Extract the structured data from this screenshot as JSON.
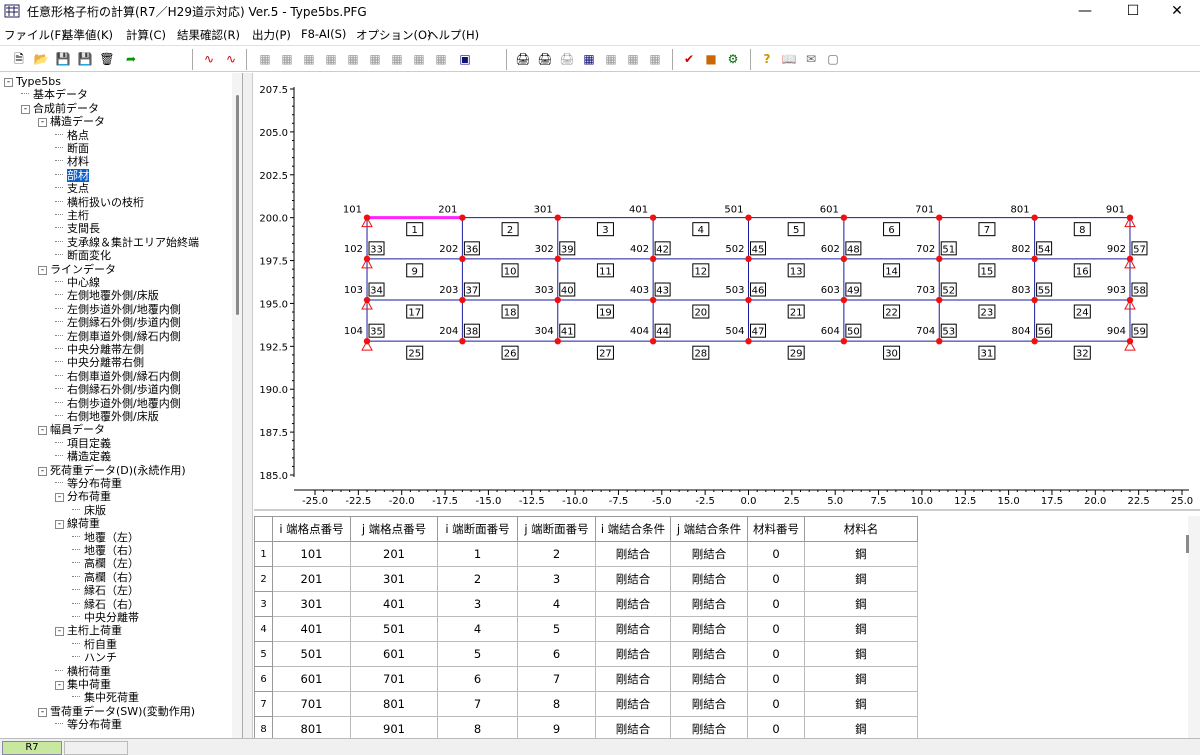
{
  "window": {
    "title": "任意形格子桁の計算(R7／H29道示対応) Ver.5 - Type5bs.PFG",
    "minimize_icon": "minimize-icon",
    "maximize_icon": "maximize-icon",
    "close_icon": "close-icon"
  },
  "menu": [
    "ファイル(F)",
    "基準値(K)",
    "計算(C)",
    "結果確認(R)",
    "出力(P)",
    "F8-AI(S)",
    "オプション(O)",
    "ヘルプ(H)"
  ],
  "toolbar": {
    "buttons": [
      "new-file-icon",
      "open-folder-icon",
      "save-icon",
      "save-as-icon",
      "delete-icon",
      "export-icon",
      "graph-line-icon",
      "graph-wave-icon",
      "table-icon",
      "chart-icon",
      "grid-icon",
      "list-icon",
      "doc-icon",
      "sheet-icon",
      "tree-icon",
      "model-icon",
      "3d-icon",
      "print-icon",
      "print-preview-icon",
      "print-setup-icon",
      "print-table-icon",
      "report-icon",
      "report-doc-icon",
      "check-icon",
      "calc-icon",
      "tool-icon",
      "help-icon",
      "book-icon",
      "web-icon",
      "info-icon"
    ]
  },
  "tree": {
    "rows": [
      {
        "label": "Type5bs",
        "level": 0,
        "exp": "-"
      },
      {
        "label": "基本データ",
        "level": 1,
        "exp": ""
      },
      {
        "label": "合成前データ",
        "level": 1,
        "exp": "-"
      },
      {
        "label": "構造データ",
        "level": 2,
        "exp": "-"
      },
      {
        "label": "格点",
        "level": 3,
        "exp": ""
      },
      {
        "label": "断面",
        "level": 3,
        "exp": ""
      },
      {
        "label": "材料",
        "level": 3,
        "exp": ""
      },
      {
        "label": "部材",
        "level": 3,
        "exp": "",
        "selected": true
      },
      {
        "label": "支点",
        "level": 3,
        "exp": ""
      },
      {
        "label": "横桁扱いの枝桁",
        "level": 3,
        "exp": ""
      },
      {
        "label": "主桁",
        "level": 3,
        "exp": ""
      },
      {
        "label": "支間長",
        "level": 3,
        "exp": ""
      },
      {
        "label": "支承線＆集計エリア始終端",
        "level": 3,
        "exp": ""
      },
      {
        "label": "断面変化",
        "level": 3,
        "exp": ""
      },
      {
        "label": "ラインデータ",
        "level": 2,
        "exp": "-"
      },
      {
        "label": "中心線",
        "level": 3,
        "exp": ""
      },
      {
        "label": "左側地覆外側/床版",
        "level": 3,
        "exp": ""
      },
      {
        "label": "左側歩道外側/地覆内側",
        "level": 3,
        "exp": ""
      },
      {
        "label": "左側縁石外側/歩道内側",
        "level": 3,
        "exp": ""
      },
      {
        "label": "左側車道外側/縁石内側",
        "level": 3,
        "exp": ""
      },
      {
        "label": "中央分離帯左側",
        "level": 3,
        "exp": ""
      },
      {
        "label": "中央分離帯右側",
        "level": 3,
        "exp": ""
      },
      {
        "label": "右側車道外側/縁石内側",
        "level": 3,
        "exp": ""
      },
      {
        "label": "右側縁石外側/歩道内側",
        "level": 3,
        "exp": ""
      },
      {
        "label": "右側歩道外側/地覆内側",
        "level": 3,
        "exp": ""
      },
      {
        "label": "右側地覆外側/床版",
        "level": 3,
        "exp": ""
      },
      {
        "label": "幅員データ",
        "level": 2,
        "exp": "-"
      },
      {
        "label": "項目定義",
        "level": 3,
        "exp": ""
      },
      {
        "label": "構造定義",
        "level": 3,
        "exp": ""
      },
      {
        "label": "死荷重データ(D)(永続作用)",
        "level": 2,
        "exp": "-"
      },
      {
        "label": "等分布荷重",
        "level": 3,
        "exp": ""
      },
      {
        "label": "分布荷重",
        "level": 3,
        "exp": "-"
      },
      {
        "label": "床版",
        "level": 4,
        "exp": ""
      },
      {
        "label": "線荷重",
        "level": 3,
        "exp": "-"
      },
      {
        "label": "地覆（左）",
        "level": 4,
        "exp": ""
      },
      {
        "label": "地覆（右）",
        "level": 4,
        "exp": ""
      },
      {
        "label": "高欄（左）",
        "level": 4,
        "exp": ""
      },
      {
        "label": "高欄（右）",
        "level": 4,
        "exp": ""
      },
      {
        "label": "縁石（左）",
        "level": 4,
        "exp": ""
      },
      {
        "label": "縁石（右）",
        "level": 4,
        "exp": ""
      },
      {
        "label": "中央分離帯",
        "level": 4,
        "exp": ""
      },
      {
        "label": "主桁上荷重",
        "level": 3,
        "exp": "-"
      },
      {
        "label": "桁自重",
        "level": 4,
        "exp": ""
      },
      {
        "label": "ハンチ",
        "level": 4,
        "exp": ""
      },
      {
        "label": "横桁荷重",
        "level": 3,
        "exp": ""
      },
      {
        "label": "集中荷重",
        "level": 3,
        "exp": "-"
      },
      {
        "label": "集中死荷重",
        "level": 4,
        "exp": ""
      },
      {
        "label": "雪荷重データ(SW)(変動作用)",
        "level": 2,
        "exp": "-"
      },
      {
        "label": "等分布荷重",
        "level": 3,
        "exp": ""
      }
    ]
  },
  "graph": {
    "y_ticks": [
      "207.5",
      "205.0",
      "202.5",
      "200.0",
      "197.5",
      "195.0",
      "192.5",
      "190.0",
      "187.5",
      "185.0"
    ],
    "x_ticks": [
      "-25.0",
      "-22.5",
      "-20.0",
      "-17.5",
      "-15.0",
      "-12.5",
      "-10.0",
      "-7.5",
      "-5.0",
      "-2.5",
      "0.0",
      "2.5",
      "5.0",
      "7.5",
      "10.0",
      "12.5",
      "15.0",
      "17.5",
      "20.0",
      "22.5",
      "25.0"
    ],
    "x_range": [
      -25,
      25
    ],
    "y_range": [
      185,
      207.5
    ],
    "node_x": [
      -22.0,
      -16.5,
      -11.0,
      -5.5,
      0.0,
      5.5,
      11.0,
      16.5,
      22.0
    ],
    "node_y": [
      200.0,
      197.6,
      195.2,
      192.8
    ],
    "node_labels_row1": [
      "101",
      "201",
      "301",
      "401",
      "501",
      "601",
      "701",
      "801",
      "901"
    ],
    "node_labels_col": [
      [
        "102",
        "202",
        "302",
        "402",
        "502",
        "602",
        "702",
        "802",
        "902"
      ],
      [
        "103",
        "203",
        "303",
        "403",
        "503",
        "603",
        "703",
        "803",
        "903"
      ],
      [
        "104",
        "204",
        "304",
        "404",
        "504",
        "604",
        "704",
        "804",
        "904"
      ]
    ],
    "member_labels_rows": [
      [
        "1",
        "2",
        "3",
        "4",
        "5",
        "6",
        "7",
        "8"
      ],
      [
        "9",
        "10",
        "11",
        "12",
        "13",
        "14",
        "15",
        "16"
      ],
      [
        "17",
        "18",
        "19",
        "20",
        "21",
        "22",
        "23",
        "24"
      ],
      [
        "25",
        "26",
        "27",
        "28",
        "29",
        "30",
        "31",
        "32"
      ]
    ],
    "cross_labels": [
      [
        "33",
        "36",
        "39",
        "42",
        "45",
        "48",
        "51",
        "54",
        "57"
      ],
      [
        "34",
        "37",
        "40",
        "43",
        "46",
        "49",
        "52",
        "55",
        "58"
      ],
      [
        "35",
        "38",
        "41",
        "44",
        "47",
        "50",
        "53",
        "56",
        "59"
      ]
    ],
    "colors": {
      "member": "#1a1aa0",
      "node": "#ee1111",
      "highlight": "#ff22ff",
      "axis": "#000000"
    }
  },
  "grid": {
    "columns": [
      "i 端格点番号",
      "j 端格点番号",
      "i 端断面番号",
      "j 端断面番号",
      "i 端結合条件",
      "j 端結合条件",
      "材料番号",
      "材料名"
    ],
    "rows": [
      [
        "1",
        "101",
        "201",
        "1",
        "2",
        "剛結合",
        "剛結合",
        "0",
        "鋼"
      ],
      [
        "2",
        "201",
        "301",
        "2",
        "3",
        "剛結合",
        "剛結合",
        "0",
        "鋼"
      ],
      [
        "3",
        "301",
        "401",
        "3",
        "4",
        "剛結合",
        "剛結合",
        "0",
        "鋼"
      ],
      [
        "4",
        "401",
        "501",
        "4",
        "5",
        "剛結合",
        "剛結合",
        "0",
        "鋼"
      ],
      [
        "5",
        "501",
        "601",
        "5",
        "6",
        "剛結合",
        "剛結合",
        "0",
        "鋼"
      ],
      [
        "6",
        "601",
        "701",
        "6",
        "7",
        "剛結合",
        "剛結合",
        "0",
        "鋼"
      ],
      [
        "7",
        "701",
        "801",
        "7",
        "8",
        "剛結合",
        "剛結合",
        "0",
        "鋼"
      ],
      [
        "8",
        "801",
        "901",
        "8",
        "9",
        "剛結合",
        "剛結合",
        "0",
        "鋼"
      ]
    ]
  },
  "status": {
    "code": "R7"
  }
}
